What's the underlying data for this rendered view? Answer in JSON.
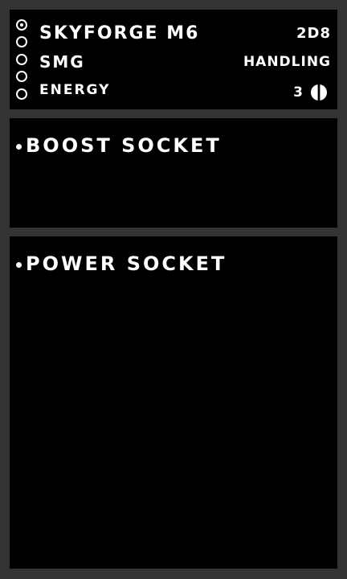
{
  "weapon": {
    "name": "SKYFORGE M6",
    "type": "SMG",
    "ammo_type": "ENERGY",
    "damage": "2D8",
    "handling_label": "HANDLING",
    "ammo_count": "3",
    "ammo_icon": "capsule-icon"
  },
  "selector": {
    "options_count": 5,
    "selected_index": 0
  },
  "sockets": [
    {
      "label": "BOOST SOCKET"
    },
    {
      "label": "POWER SOCKET"
    }
  ]
}
